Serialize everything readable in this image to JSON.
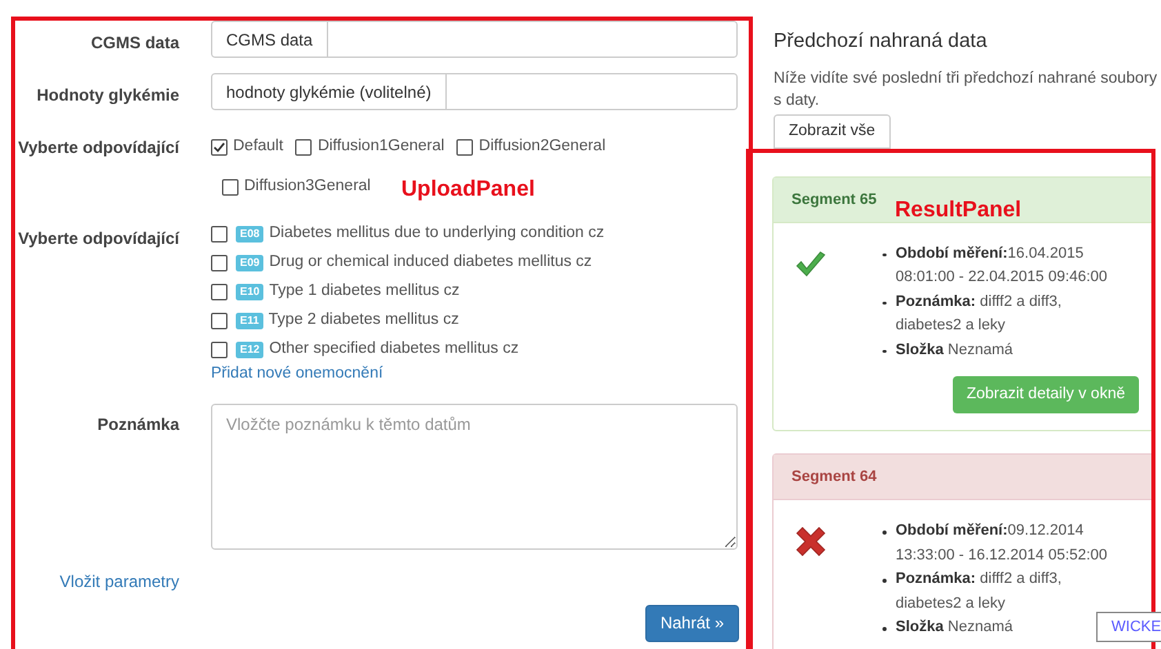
{
  "upload_panel": {
    "annotation": "UploadPanel",
    "cgms": {
      "label": "CGMS data",
      "button": "CGMS data"
    },
    "glycemia": {
      "label": "Hodnoty glykémie",
      "button": "hodnoty glykémie (volitelné)"
    },
    "models": {
      "label": "Vyberte odpovídající",
      "options": [
        {
          "label": "Default",
          "checked": true
        },
        {
          "label": "Diffusion1General",
          "checked": false
        },
        {
          "label": "Diffusion2General",
          "checked": false
        },
        {
          "label": "Diffusion3General",
          "checked": false
        }
      ]
    },
    "diseases": {
      "label": "Vyberte odpovídající",
      "options": [
        {
          "code": "E08",
          "label": "Diabetes mellitus due to underlying condition cz",
          "checked": false
        },
        {
          "code": "E09",
          "label": "Drug or chemical induced diabetes mellitus cz",
          "checked": false
        },
        {
          "code": "E10",
          "label": "Type 1 diabetes mellitus cz",
          "checked": false
        },
        {
          "code": "E11",
          "label": "Type 2 diabetes mellitus cz",
          "checked": false
        },
        {
          "code": "E12",
          "label": "Other specified diabetes mellitus cz",
          "checked": false
        }
      ],
      "add_link": "Přidat nové onemocnění"
    },
    "note": {
      "label": "Poznámka",
      "placeholder": "Vložčte poznámku k těmto datům"
    },
    "params_link": "Vložit parametry",
    "submit": "Nahrát »"
  },
  "previous": {
    "title": "Předchozí nahraná data",
    "description": "Níže vidíte své poslední tři předchozí nahrané soubory s daty.",
    "show_all": "Zobrazit vše"
  },
  "result_panel": {
    "annotation": "ResultPanel",
    "segments": [
      {
        "title": "Segment 65",
        "kind": "success",
        "items": [
          {
            "label": "Období měření:",
            "value": "16.04.2015 08:01:00 - 22.04.2015 09:46:00"
          },
          {
            "label": "Poznámka:",
            "value": " difff2 a diff3, diabetes2 a leky"
          },
          {
            "label": "Složka",
            "value": " Neznamá"
          }
        ],
        "button": "Zobrazit detaily v okně"
      },
      {
        "title": "Segment 64",
        "kind": "error",
        "items": [
          {
            "label": "Období měření:",
            "value": "09.12.2014 13:33:00 - 16.12.2014 05:52:00"
          },
          {
            "label": "Poznámka:",
            "value": " difff2 a diff3, diabetes2 a leky"
          },
          {
            "label": "Složka",
            "value": " Neznamá"
          }
        ]
      }
    ]
  },
  "debug_tag": "WICKE"
}
